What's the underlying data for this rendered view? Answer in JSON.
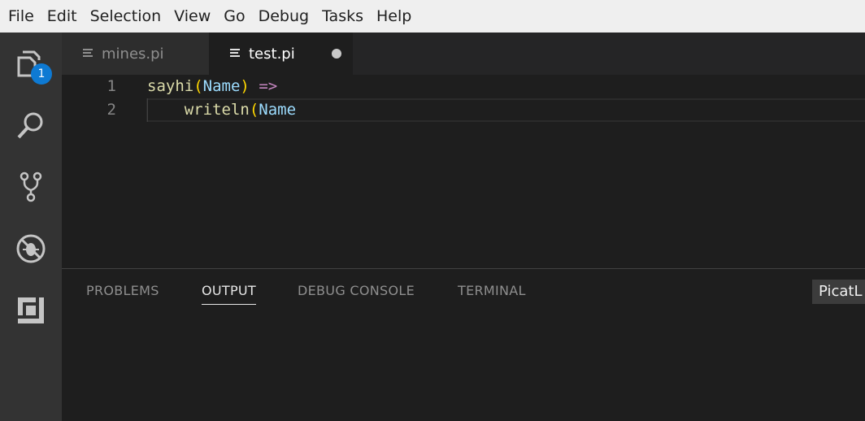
{
  "menubar": {
    "items": [
      "File",
      "Edit",
      "Selection",
      "View",
      "Go",
      "Debug",
      "Tasks",
      "Help"
    ]
  },
  "activity_bar": {
    "explorer_badge": "1",
    "icons": [
      "files-icon",
      "search-icon",
      "source-control-icon",
      "debug-icon",
      "extensions-icon"
    ]
  },
  "tabs": [
    {
      "label": "mines.pi",
      "active": false
    },
    {
      "label": "test.pi",
      "active": true,
      "dirty": true
    }
  ],
  "editor": {
    "lines": [
      {
        "number": "1",
        "tokens": [
          {
            "text": "sayhi",
            "kind": "fn"
          },
          {
            "text": "(",
            "kind": "br"
          },
          {
            "text": "Name",
            "kind": "var"
          },
          {
            "text": ")",
            "kind": "br"
          },
          {
            "text": " ",
            "kind": "plain"
          },
          {
            "text": "=>",
            "kind": "op"
          }
        ]
      },
      {
        "number": "2",
        "tokens": [
          {
            "text": "    ",
            "kind": "plain"
          },
          {
            "text": "writeln",
            "kind": "fn"
          },
          {
            "text": "(",
            "kind": "br"
          },
          {
            "text": "Name",
            "kind": "var"
          }
        ]
      }
    ]
  },
  "panel": {
    "tabs": [
      "PROBLEMS",
      "OUTPUT",
      "DEBUG CONSOLE",
      "TERMINAL"
    ],
    "active_tab": "OUTPUT",
    "channel": "PicatL"
  },
  "colors": {
    "menubar_bg": "#efefef",
    "activity_bg": "#333333",
    "editor_bg": "#1e1e1e",
    "badge": "#0e7ad3"
  }
}
